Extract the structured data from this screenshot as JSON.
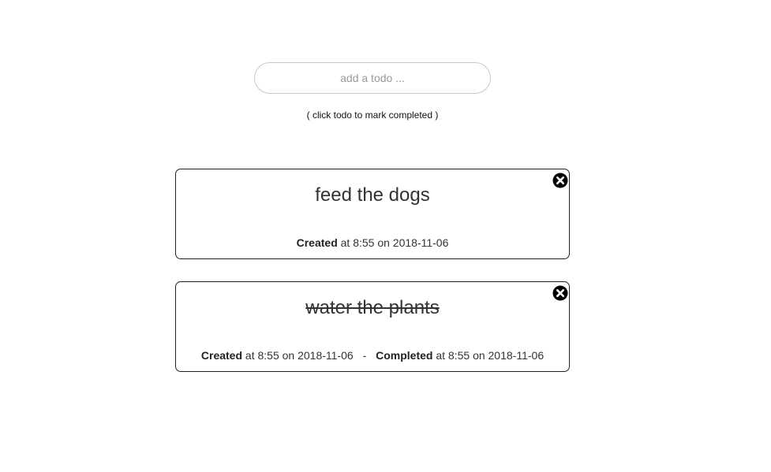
{
  "input": {
    "placeholder": "add a todo ...",
    "value": ""
  },
  "hint": "( click todo to mark completed )",
  "labels": {
    "created": "Created",
    "completed": "Completed",
    "separator": "-"
  },
  "todos": [
    {
      "title": "feed the dogs",
      "completed": false,
      "created_text": "at 8:55 on 2018-11-06"
    },
    {
      "title": "water the plants",
      "completed": true,
      "created_text": "at 8:55 on 2018-11-06",
      "completed_text": "at 8:55 on 2018-11-06"
    }
  ],
  "icons": {
    "delete": "close-circle-icon"
  }
}
